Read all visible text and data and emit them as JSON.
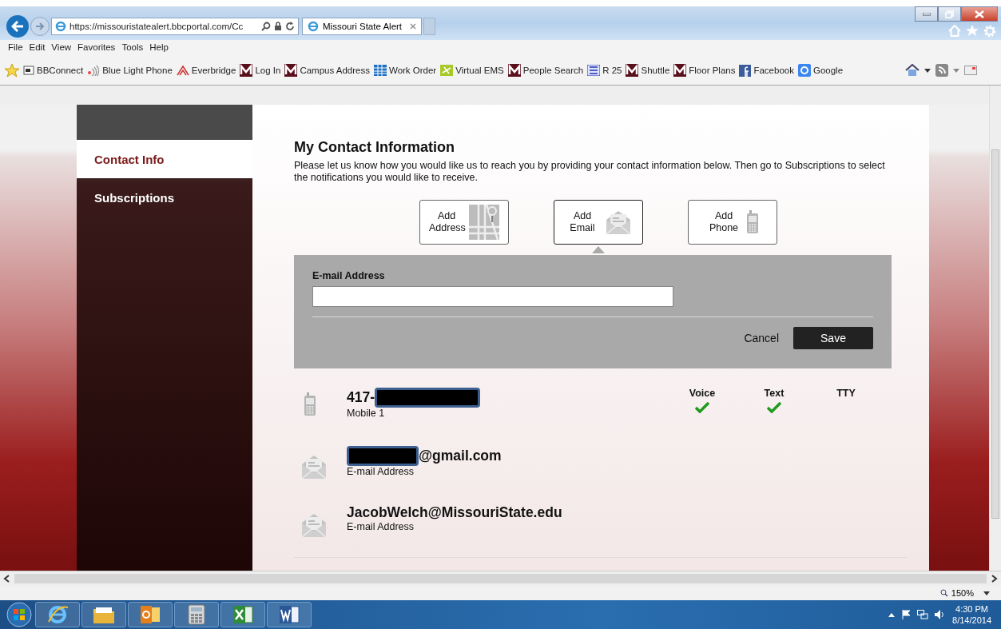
{
  "browser": {
    "address": "https://missouristatealert.bbcportal.com/Cc",
    "tabs": [
      {
        "title": "Missouri State Alert",
        "selected": true
      }
    ],
    "menu": [
      "File",
      "Edit",
      "View",
      "Favorites",
      "Tools",
      "Help"
    ],
    "favorites": [
      {
        "label": "BBConnect",
        "kind": "page"
      },
      {
        "label": "Blue Light Phone",
        "kind": "signal"
      },
      {
        "label": "Everbridge",
        "kind": "peaks"
      },
      {
        "label": "Log In",
        "kind": "m"
      },
      {
        "label": "Campus Address",
        "kind": "m"
      },
      {
        "label": "Work Order",
        "kind": "grid"
      },
      {
        "label": "Virtual EMS",
        "kind": "star"
      },
      {
        "label": "People Search",
        "kind": "m"
      },
      {
        "label": "R 25",
        "kind": "r25"
      },
      {
        "label": "Shuttle",
        "kind": "m"
      },
      {
        "label": "Floor Plans",
        "kind": "m"
      },
      {
        "label": "Facebook",
        "kind": "f"
      },
      {
        "label": "Google",
        "kind": "g"
      }
    ],
    "zoom": "150%"
  },
  "sidebar": {
    "items": [
      {
        "label": "Contact Info",
        "selected": true
      },
      {
        "label": "Subscriptions",
        "selected": false
      }
    ]
  },
  "content": {
    "title": "My Contact Information",
    "description": "Please let us know how you would like us to reach you by providing your contact information below. Then go to Subscriptions to select the notifications you would like to receive.",
    "add_buttons": [
      {
        "label": "Add Address",
        "kind": "address",
        "selected": false
      },
      {
        "label": "Add Email",
        "kind": "email",
        "selected": true
      },
      {
        "label": "Add Phone",
        "kind": "phone",
        "selected": false
      }
    ],
    "email_form": {
      "label": "E-mail Address",
      "buttons": {
        "cancel": "Cancel",
        "save": "Save"
      }
    },
    "contacts": [
      {
        "kind": "phone",
        "value": "417-",
        "redacted_after": true,
        "type_label": "Mobile 1",
        "methods": [
          {
            "label": "Voice",
            "checked": true
          },
          {
            "label": "Text",
            "checked": true
          },
          {
            "label": "TTY",
            "checked": false
          }
        ]
      },
      {
        "kind": "email",
        "value": "@gmail.com",
        "redacted_before": true,
        "type_label": "E-mail Address"
      },
      {
        "kind": "email",
        "value": "JacobWelch@MissouriState.edu",
        "type_label": "E-mail Address"
      }
    ]
  },
  "taskbar": {
    "apps": [
      {
        "kind": "ie"
      },
      {
        "kind": "folder"
      },
      {
        "kind": "outlook"
      },
      {
        "kind": "calculator"
      },
      {
        "kind": "excel"
      },
      {
        "kind": "word"
      }
    ],
    "time": "4:30 PM",
    "date": "8/14/2014"
  }
}
